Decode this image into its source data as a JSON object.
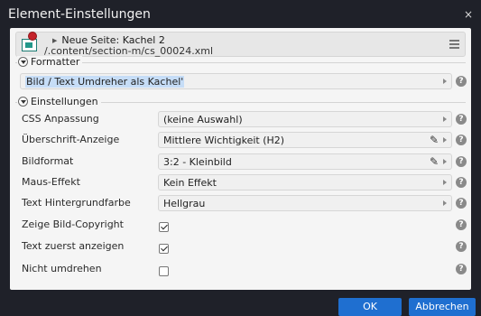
{
  "dialog": {
    "title": "Element-Einstellungen",
    "close": "×"
  },
  "resource": {
    "title": "Neue Seite: Kachel 2",
    "path": "/.content/section-m/cs_00024.xml"
  },
  "formatter": {
    "legend": "Formatter",
    "value": "Bild / Text Umdreher als Kachel'"
  },
  "settings": {
    "legend": "Einstellungen",
    "rows": [
      {
        "label": "CSS Anpassung",
        "value": "(keine Auswahl)"
      },
      {
        "label": "Überschrift-Anzeige",
        "value": "Mittlere Wichtigkeit (H2)"
      },
      {
        "label": "Bildformat",
        "value": "3:2 - Kleinbild"
      },
      {
        "label": "Maus-Effekt",
        "value": "Kein Effekt"
      },
      {
        "label": "Text Hintergrundfarbe",
        "value": "Hellgrau"
      }
    ],
    "checkboxes": [
      {
        "label": "Zeige Bild-Copyright",
        "checked": true
      },
      {
        "label": "Text zuerst anzeigen",
        "checked": true
      },
      {
        "label": "Nicht umdrehen",
        "checked": false
      }
    ]
  },
  "help_glyph": "?",
  "footer": {
    "ok_label": "OK",
    "cancel_label": "Abbrechen"
  },
  "colors": {
    "dialog_bg": "#1f2129",
    "content_bg": "#f5f5f5",
    "primary_button": "#1f6fd0",
    "selected_text_bg": "#c6ddf7"
  }
}
